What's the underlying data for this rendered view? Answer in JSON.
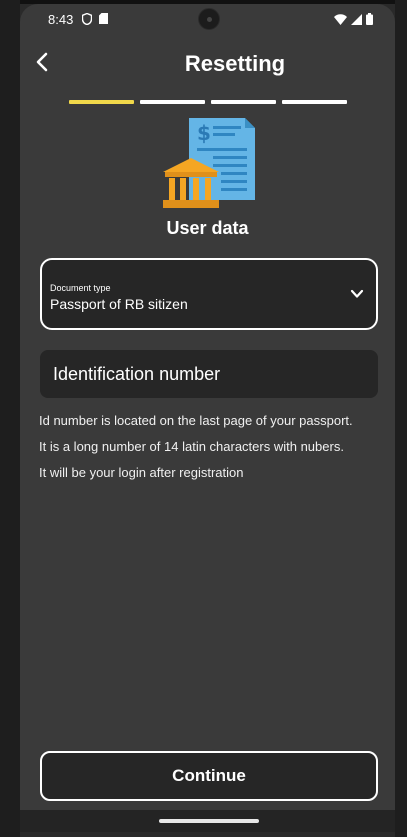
{
  "status_bar": {
    "time": "8:43",
    "left_icons": [
      "shield-icon",
      "sd-card-icon"
    ],
    "right_icons": [
      "wifi-icon",
      "cellular-signal-icon",
      "battery-icon"
    ]
  },
  "header": {
    "title": "Resetting",
    "back_icon": "chevron-left-icon"
  },
  "progress": {
    "total_steps": 4,
    "current_step": 1,
    "active_color": "#f1d84a",
    "inactive_color": "#ffffff"
  },
  "illustration": {
    "icon": "bank-document-icon",
    "colors": {
      "document": "#64b5e6",
      "bank": "#f5a623"
    }
  },
  "section": {
    "title": "User data"
  },
  "document_type": {
    "label": "Document type",
    "value": "Passport of RB sitizen",
    "icon": "chevron-down-icon"
  },
  "id_field": {
    "placeholder": "Identification number",
    "value": ""
  },
  "help": {
    "lines": [
      "Id number is located on the last page of your passport.",
      "It is a long number of 14 latin characters with nubers.",
      "It will be your login after registration"
    ]
  },
  "continue_button": {
    "label": "Continue"
  },
  "theme": {
    "background": "#3a3a3a",
    "field_background": "#262626",
    "text": "#ffffff"
  }
}
